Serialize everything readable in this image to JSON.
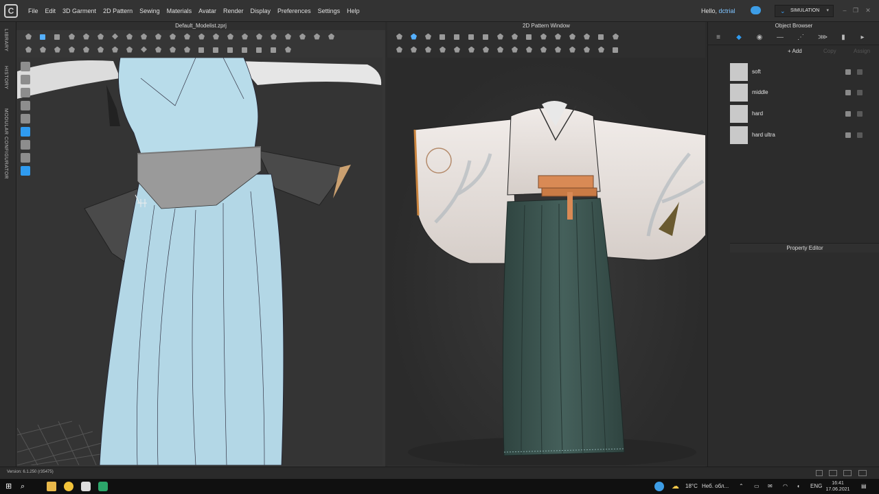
{
  "menu": {
    "items": [
      "File",
      "Edit",
      "3D Garment",
      "2D Pattern",
      "Sewing",
      "Materials",
      "Avatar",
      "Render",
      "Display",
      "Preferences",
      "Settings",
      "Help"
    ],
    "hello_prefix": "Hello,",
    "username": "dctrial",
    "mode": "SIMULATION"
  },
  "left_tabs": [
    "LIBRARY",
    "HISTORY",
    "MODULAR CONFIGURATOR"
  ],
  "window3d": {
    "title": "Default_Modelist.zprj"
  },
  "window2d": {
    "title": "2D Pattern Window"
  },
  "object_browser": {
    "title": "Object Browser",
    "actions": {
      "add": "+ Add",
      "copy": "Copy",
      "assign": "Assign"
    },
    "fabrics": [
      {
        "name": "soft"
      },
      {
        "name": "middle"
      },
      {
        "name": "hard"
      },
      {
        "name": "hard ultra"
      }
    ]
  },
  "property_editor": {
    "title": "Property Editor"
  },
  "status": {
    "version": "Version: 6.1.250 (r35475)"
  },
  "taskbar": {
    "weather": "18°C",
    "weather_text": "Неб. обл...",
    "lang": "ENG",
    "time": "16:41",
    "date": "17.06.2021"
  },
  "colors": {
    "accent": "#2f9bf0",
    "garment_3d": "#b8dcea",
    "kimono_white": "#e8e2de",
    "hakama_green": "#3e5652",
    "obi_orange": "#d98a55"
  }
}
